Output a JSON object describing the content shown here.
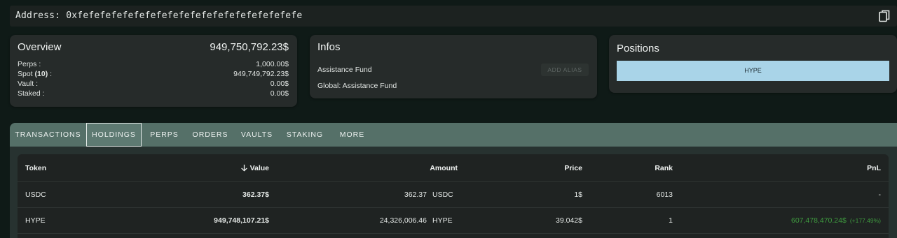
{
  "address": {
    "text": "Address: 0xfefefefefefefefefefefefefefefefefefefefe",
    "copy_icon": "copy-icon"
  },
  "overview": {
    "title": "Overview",
    "total": "949,750,792.23$",
    "rows": [
      {
        "label": "Perps :",
        "value": "1,000.00$"
      },
      {
        "label_prefix": "Spot ",
        "label_count": "(10)",
        "label_suffix": " :",
        "value": "949,749,792.23$"
      },
      {
        "label": "Vault :",
        "value": "0.00$"
      },
      {
        "label": "Staked :",
        "value": "0.00$"
      }
    ]
  },
  "infos": {
    "title": "Infos",
    "name": "Assistance Fund",
    "global": "Global: Assistance Fund",
    "add_alias": "ADD ALIAS"
  },
  "positions": {
    "title": "Positions",
    "chip": "HYPE",
    "chip_color": "#a9d4e8"
  },
  "tabs": [
    {
      "label": "TRANSACTIONS"
    },
    {
      "label": "HOLDINGS",
      "active": true
    },
    {
      "label": "PERPS"
    },
    {
      "label": "ORDERS"
    },
    {
      "label": "VAULTS"
    },
    {
      "label": "STAKING"
    },
    {
      "label": "MORE"
    }
  ],
  "table": {
    "columns": {
      "token": "Token",
      "value": "Value",
      "value_sort_icon": "arrow-down-icon",
      "amount": "Amount",
      "price": "Price",
      "rank": "Rank",
      "pnl": "PnL"
    },
    "rows": [
      {
        "token": "USDC",
        "value": "362.37$",
        "amount": "362.37",
        "amount_symbol": "USDC",
        "price": "1$",
        "rank": "6013",
        "pnl": "-",
        "pnl_pct": ""
      },
      {
        "token": "HYPE",
        "value": "949,748,107.21$",
        "amount": "24,326,006.46",
        "amount_symbol": "HYPE",
        "price": "39.042$",
        "rank": "1",
        "pnl": "607,478,470.24$",
        "pnl_pct": "(+177.49%)"
      }
    ]
  },
  "colors": {
    "background": "#0f1a17",
    "card": "#262b2a",
    "tab_bar": "#557068",
    "pnl_positive": "#3f9b3f"
  }
}
